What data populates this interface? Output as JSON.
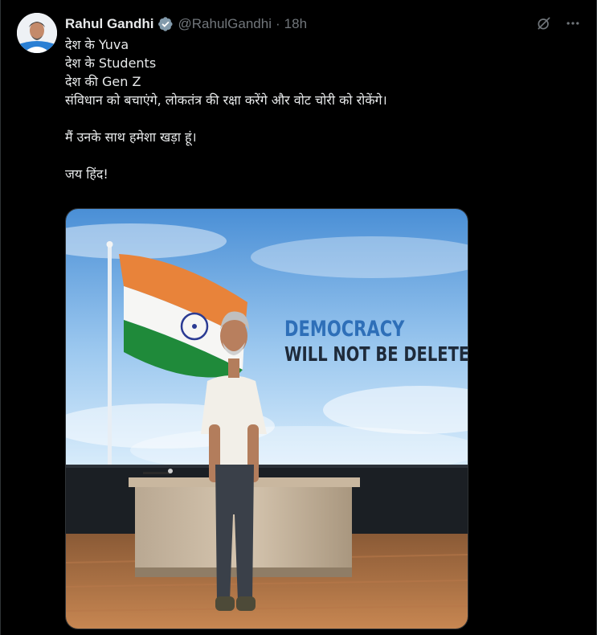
{
  "post": {
    "author": {
      "display_name": "Rahul Gandhi",
      "handle": "@RahulGandhi",
      "verified": true,
      "verified_icon": "verified-badge-icon",
      "avatar_icon": "avatar"
    },
    "separator": "·",
    "time": "18h",
    "text_lines": [
      "देश के Yuva",
      "देश के Students",
      "देश की Gen Z",
      "संविधान को बचाएंगे, लोकतंत्र की रक्षा करेंगे और वोट चोरी को रोकेंगे।",
      "",
      "मैं उनके साथ हमेशा खड़ा हूं।",
      "",
      "जय हिंद!"
    ],
    "media": {
      "headline_1": "DEMOCRACY",
      "headline_2": "WILL NOT BE DELETED"
    }
  },
  "icons": {
    "grok": "grok-icon",
    "more": "more-icon"
  },
  "colors": {
    "background": "#000000",
    "text": "#e7e9ea",
    "muted": "#71767b",
    "verified": "#829aab",
    "border": "#2f3336"
  }
}
